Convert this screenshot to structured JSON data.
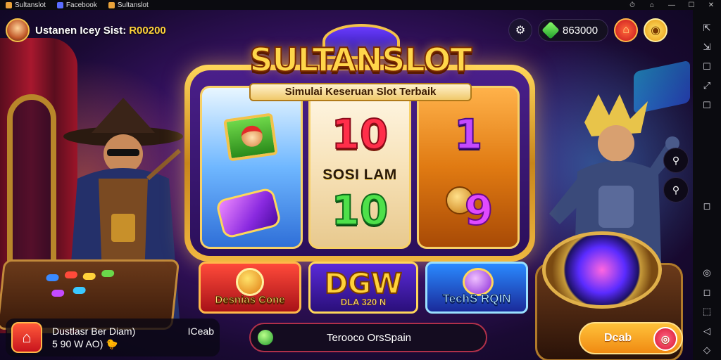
{
  "window": {
    "tabs": [
      {
        "label": "Sultanslot",
        "icon": "app-icon"
      },
      {
        "label": "Facebook",
        "icon": "tab-icon"
      },
      {
        "label": "Sultanslot",
        "icon": "tab-icon"
      }
    ],
    "controls": [
      "⏱",
      "⌂",
      "—",
      "☐",
      "✕"
    ]
  },
  "header": {
    "player_label": "Ustanen Icey Sist:",
    "player_amount": "R00200",
    "balance": "863000",
    "icons": {
      "settings": "gear-icon",
      "balance": "gem-icon",
      "home": "home-icon",
      "coin": "coin-icon"
    }
  },
  "machine": {
    "title": "SULTANSLOT",
    "subtitle": "Simulai Keseruan Slot Terbaik",
    "reels": {
      "reel2_top": "10",
      "reel2_mid": "SOSI LAM",
      "reel2_bottom": "10",
      "reel3_top": "1",
      "reel3_bottom": "9"
    }
  },
  "tiles": [
    {
      "label": "Desnias Cone"
    },
    {
      "big": "DGW",
      "sub": "DLA 320 N"
    },
    {
      "label": "TechS RQIN"
    }
  ],
  "bottom": {
    "left_line1": "Dustlasr Ber Diam)",
    "left_line2": "5 90 W AO) 🐤",
    "left_right": "ICeab",
    "search_text": "Terooco OrsSpain",
    "play_label": "Dcab"
  },
  "sidebar": {
    "icons": [
      "⇱",
      "⇲",
      "☐",
      "⤢",
      "☐",
      "◻",
      "◎",
      "◻",
      "⬚",
      "◁",
      "◇"
    ]
  },
  "colors": {
    "accent": "#ffd23a",
    "brand": "#7b2fb8",
    "danger": "#c8141e"
  }
}
